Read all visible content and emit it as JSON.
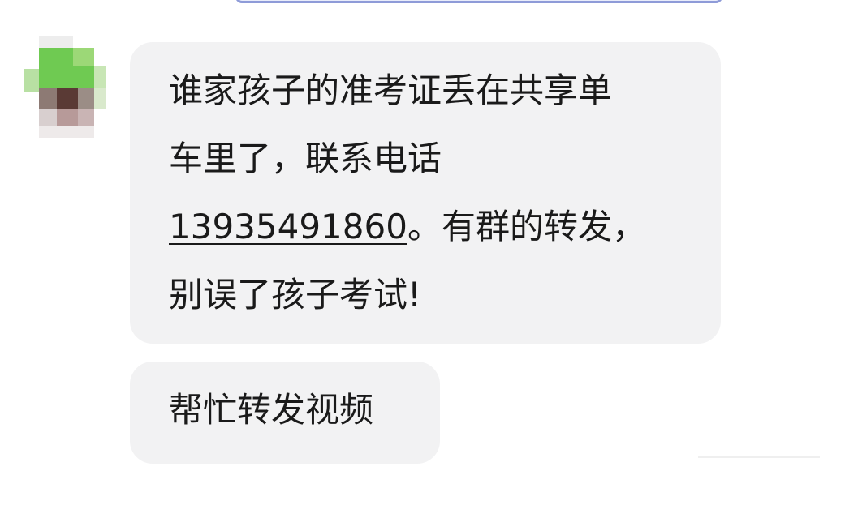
{
  "chat": {
    "messages": [
      {
        "line1": "谁家孩子的准考证丢在共享单",
        "line2": "车里了，联系电话",
        "phone": "13935491860",
        "line3_rest": "。有群的转发，",
        "line4": "别误了孩子考试!"
      },
      {
        "text": "帮忙转发视频"
      }
    ]
  },
  "colors": {
    "bubble_bg": "#f2f2f3",
    "text": "#1a1a1a",
    "top_bar_border": "#8e9bd8"
  }
}
